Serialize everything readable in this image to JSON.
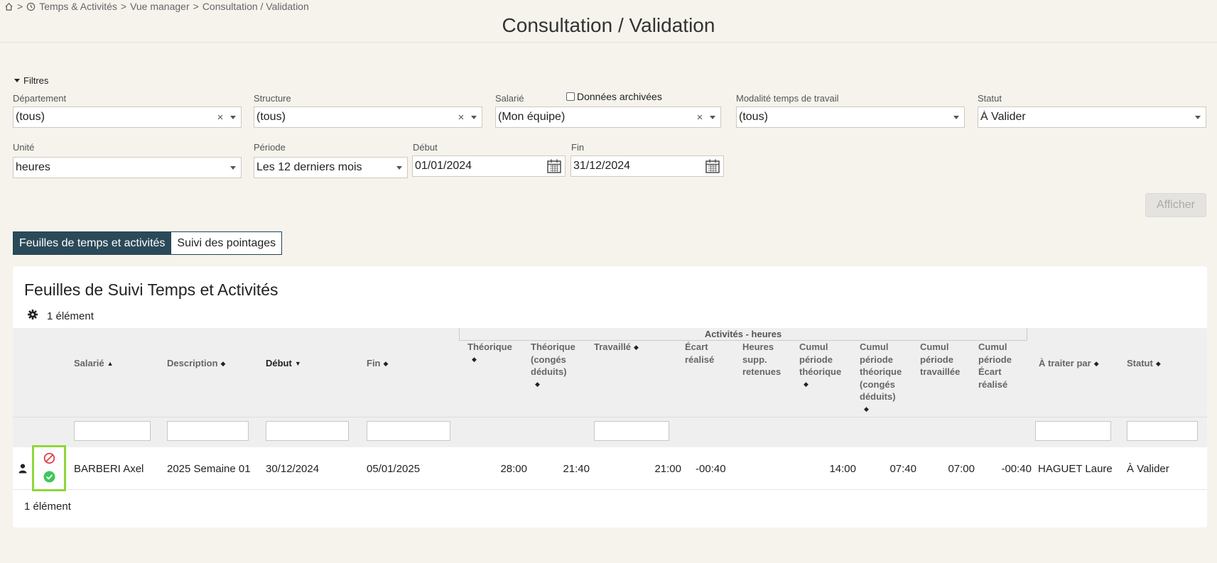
{
  "breadcrumb": {
    "home_icon": "home-icon",
    "sep1": ">",
    "clock_icon": "clock-icon",
    "item1": "Temps & Activités",
    "sep2": ">",
    "item2": "Vue manager",
    "sep3": ">",
    "item3": "Consultation / Validation"
  },
  "page_title": "Consultation / Validation",
  "filters": {
    "toggle_label": "Filtres",
    "departement": {
      "label": "Département",
      "value": "(tous)",
      "clear": "×"
    },
    "structure": {
      "label": "Structure",
      "value": "(tous)",
      "clear": "×"
    },
    "salarie": {
      "label": "Salarié",
      "value": "(Mon équipe)",
      "clear": "×"
    },
    "archived_label": "Données archivées",
    "modalite": {
      "label": "Modalité temps de travail",
      "value": "(tous)"
    },
    "statut": {
      "label": "Statut",
      "value": "À Valider"
    },
    "unite": {
      "label": "Unité",
      "value": "heures"
    },
    "periode": {
      "label": "Période",
      "value": "Les 12 derniers mois"
    },
    "debut": {
      "label": "Début",
      "value": "01/01/2024"
    },
    "fin": {
      "label": "Fin",
      "value": "31/12/2024"
    },
    "submit_label": "Afficher"
  },
  "tabs": [
    {
      "label": "Feuilles de temps et activités",
      "active": true
    },
    {
      "label": "Suivi des pointages",
      "active": false
    }
  ],
  "table": {
    "title": "Feuilles de Suivi Temps et Activités",
    "count": "1 élément",
    "group_header": "Activités - heures",
    "headers": {
      "salarie": "Salarié",
      "description": "Description",
      "debut": "Début",
      "fin": "Fin",
      "theorique": "Théorique",
      "theorique_conges": [
        "Théorique",
        "(congés",
        "déduits)"
      ],
      "travaille": "Travaillé",
      "ecart": [
        "Écart",
        "réalisé"
      ],
      "heures_supp": [
        "Heures",
        "supp.",
        "retenues"
      ],
      "cumul_theorique": [
        "Cumul",
        "période",
        "théorique"
      ],
      "cumul_theorique_conges": [
        "Cumul",
        "période",
        "théorique",
        "(congés",
        "déduits)"
      ],
      "cumul_travaillee": [
        "Cumul",
        "période",
        "travaillée"
      ],
      "cumul_ecart": [
        "Cumul",
        "période",
        "Écart",
        "réalisé"
      ],
      "a_traiter_par": "À traiter par",
      "statut": "Statut"
    },
    "rows": [
      {
        "salarie": "BARBERI Axel",
        "description": "2025 Semaine 01",
        "debut": "30/12/2024",
        "fin": "05/01/2025",
        "theorique": "28:00",
        "theorique_conges": "21:40",
        "travaille": "21:00",
        "ecart": "-00:40",
        "heures_supp": "",
        "cumul_theorique": "14:00",
        "cumul_theorique_conges": "07:40",
        "cumul_travaillee": "07:00",
        "cumul_ecart": "-00:40",
        "a_traiter_par": "HAGUET Laure",
        "statut": "À Valider"
      }
    ],
    "footer_count": "1 élément"
  },
  "colors": {
    "tab_active": "#2b4a59",
    "reject": "#e0333a",
    "validate": "#3cc85a",
    "highlight": "#8fd63b"
  }
}
